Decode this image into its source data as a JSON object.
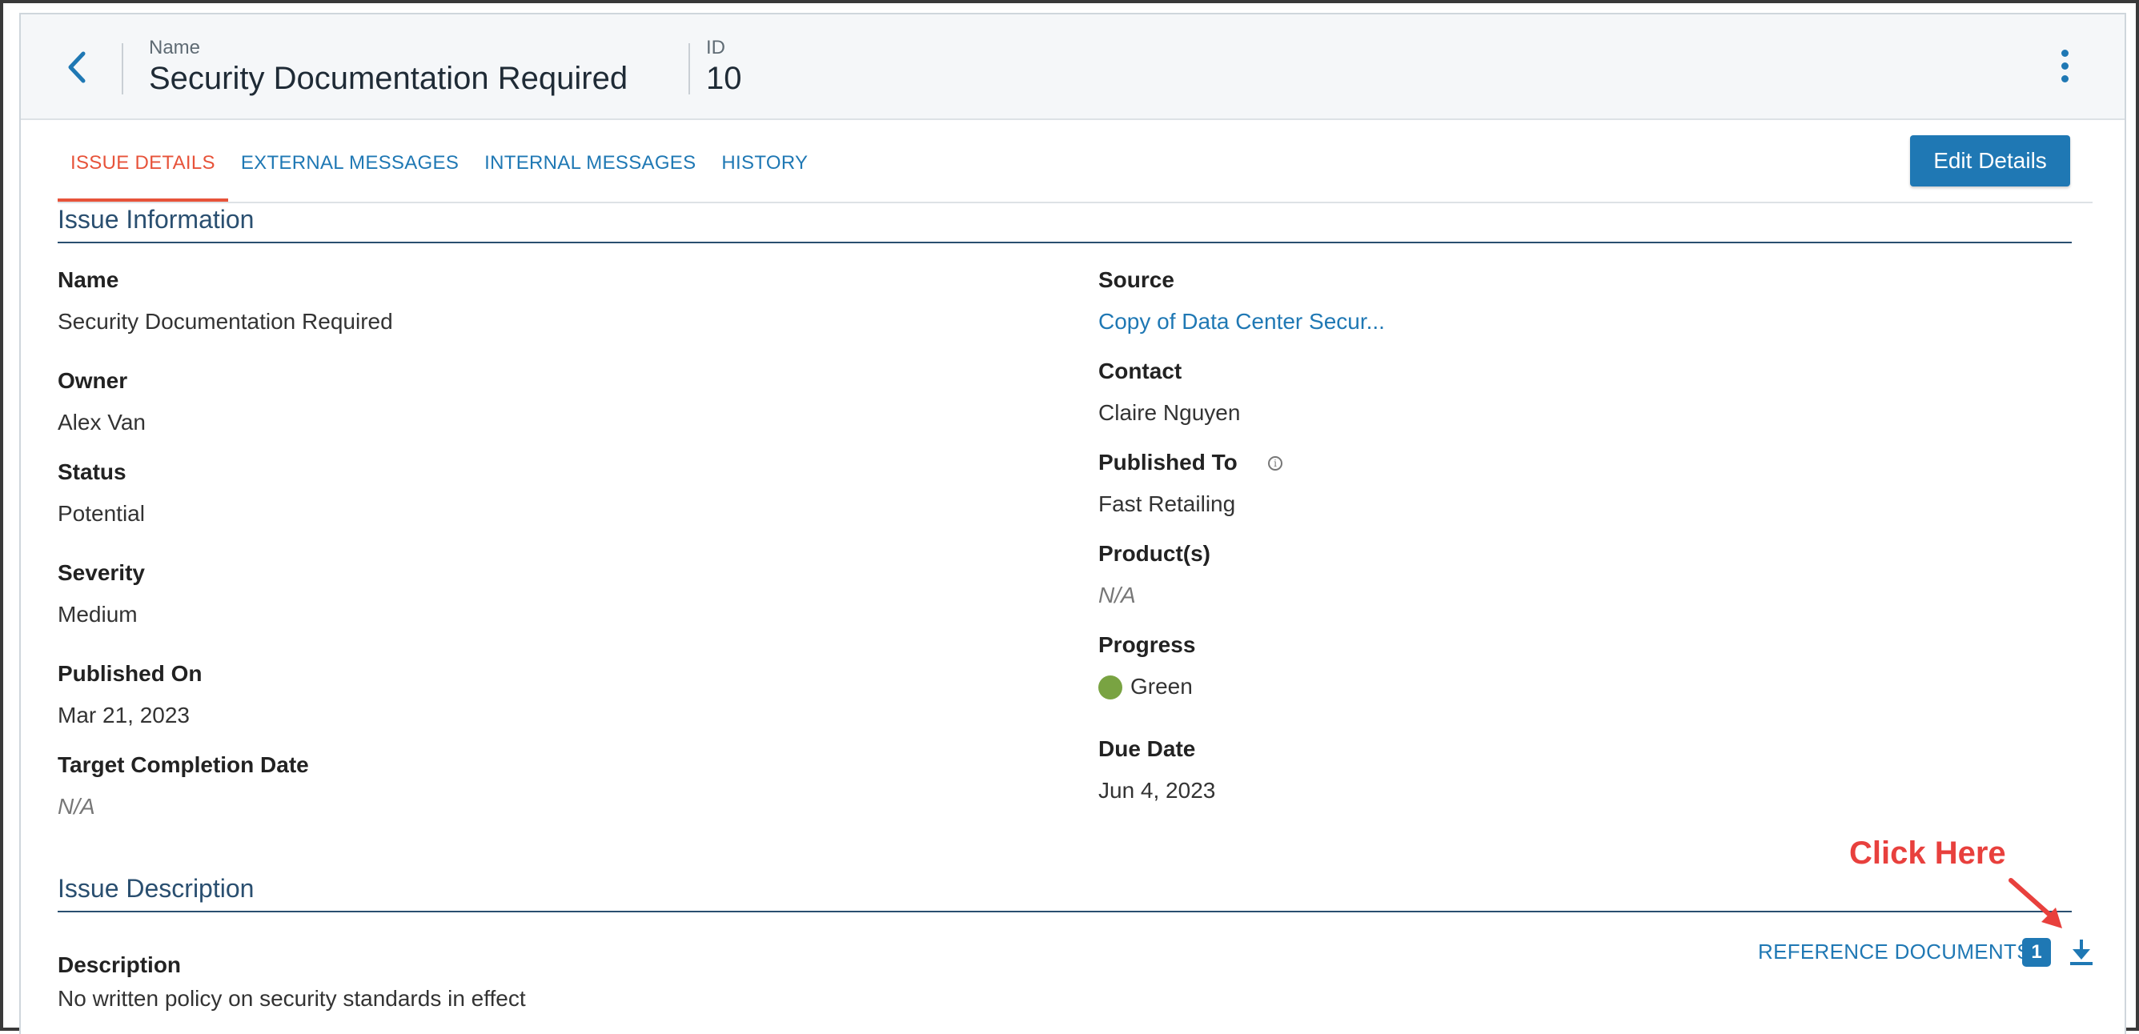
{
  "header": {
    "name_label": "Name",
    "name_value": "Security Documentation Required",
    "id_label": "ID",
    "id_value": "10"
  },
  "tabs": [
    {
      "label": "ISSUE DETAILS",
      "active": true
    },
    {
      "label": "EXTERNAL MESSAGES",
      "active": false
    },
    {
      "label": "INTERNAL MESSAGES",
      "active": false
    },
    {
      "label": "HISTORY",
      "active": false
    }
  ],
  "edit_button": "Edit Details",
  "issue_information": {
    "title": "Issue Information",
    "left": [
      {
        "label": "Name",
        "value": "Security Documentation Required"
      },
      {
        "label": "Owner",
        "value": "Alex Van"
      },
      {
        "label": "Status",
        "value": "Potential"
      },
      {
        "label": "Severity",
        "value": "Medium"
      },
      {
        "label": "Published On",
        "value": "Mar 21, 2023"
      },
      {
        "label": "Target Completion Date",
        "value": "N/A"
      }
    ],
    "right": [
      {
        "label": "Source",
        "value": "Copy of Data Center Secur..."
      },
      {
        "label": "Contact",
        "value": "Claire Nguyen"
      },
      {
        "label": "Published To",
        "value": "Fast Retailing"
      },
      {
        "label": "Product(s)",
        "value": "N/A"
      },
      {
        "label": "Progress",
        "value": "Green"
      },
      {
        "label": "Due Date",
        "value": "Jun 4, 2023"
      }
    ]
  },
  "issue_description": {
    "title": "Issue Description",
    "description_label": "Description",
    "description_value": "No written policy on security standards in effect",
    "reference_documents_label": "REFERENCE DOCUMENTS",
    "reference_documents_count": "1"
  },
  "annotation": {
    "text": "Click Here"
  },
  "colors": {
    "accent": "#1f78b4",
    "active_tab": "#e7533a",
    "section_title": "#2a4f70",
    "progress_green": "#79a342",
    "annotation_red": "#e8403d"
  },
  "icons": {
    "back": "chevron-left-icon",
    "menu": "kebab-menu-icon",
    "info": "info-icon",
    "download": "download-icon",
    "annotation_arrow": "arrow-icon"
  }
}
